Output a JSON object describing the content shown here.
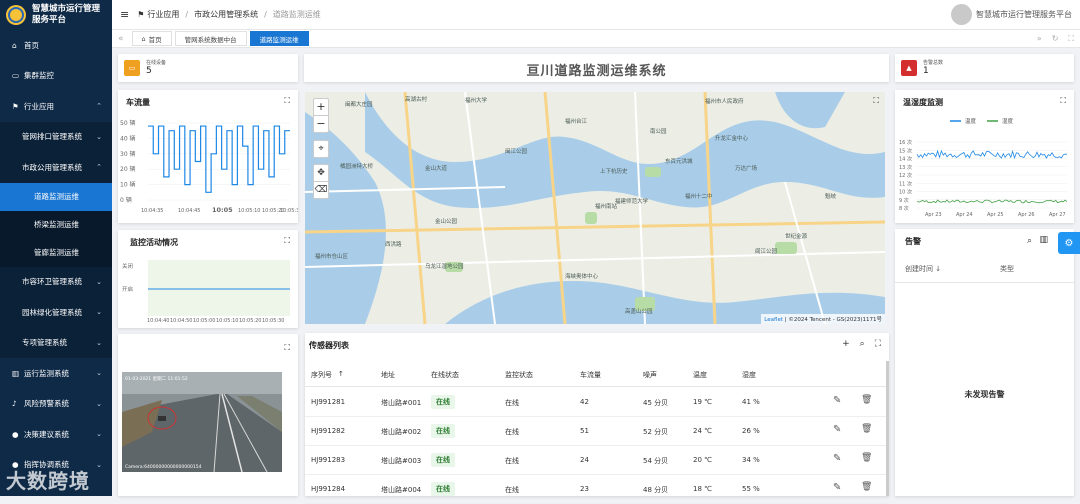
{
  "app": {
    "title_line1": "智慧城市运行管理",
    "title_line2": "服务平台",
    "user_name": "智慧城市运行管理服务平台"
  },
  "sidebar": {
    "items": [
      {
        "label": "首页",
        "icon": "home-icon",
        "level": 0
      },
      {
        "label": "集群监控",
        "icon": "monitor-icon",
        "level": 0
      },
      {
        "label": "行业应用",
        "icon": "flag-icon",
        "level": 0,
        "chevron": "⌃"
      },
      {
        "label": "管网排口管理系统",
        "level": 1,
        "chevron": "⌄"
      },
      {
        "label": "市政公用管理系统",
        "level": 1,
        "chevron": "⌃"
      },
      {
        "label": "道路监测运维",
        "level": 2,
        "active": true
      },
      {
        "label": "桥梁监测运维",
        "level": 2
      },
      {
        "label": "管廊监测运维",
        "level": 2
      },
      {
        "label": "市容环卫管理系统",
        "level": 1,
        "chevron": "⌄"
      },
      {
        "label": "园林绿化管理系统",
        "level": 1,
        "chevron": "⌄"
      },
      {
        "label": "专项管理系统",
        "level": 1,
        "chevron": "⌄"
      },
      {
        "label": "运行监测系统",
        "icon": "chart-icon",
        "level": 0,
        "chevron": "⌄"
      },
      {
        "label": "风险预警系统",
        "icon": "bell-icon",
        "level": 0,
        "chevron": "⌄"
      },
      {
        "label": "决策建议系统",
        "icon": "person-icon",
        "level": 0,
        "chevron": "⌄"
      },
      {
        "label": "指挥协调系统",
        "icon": "person-icon",
        "level": 0,
        "chevron": "⌄"
      }
    ]
  },
  "breadcrumb": {
    "item1": "行业应用",
    "item2": "市政公用管理系统",
    "item3": "道路监测运维"
  },
  "tabs": [
    {
      "label": "首页",
      "active": false
    },
    {
      "label": "管网系统数据中台",
      "active": false
    },
    {
      "label": "道路监测运维",
      "active": true
    }
  ],
  "stats": {
    "online": {
      "label": "在线设备",
      "value": "5",
      "color": "#f0a020"
    },
    "alarm": {
      "label": "告警总数",
      "value": "1",
      "color": "#d32f2f"
    }
  },
  "page_title": "亘川道路监测运维系统",
  "traffic": {
    "title": "车流量",
    "y_ticks": [
      "50 辆",
      "40 辆",
      "30 辆",
      "20 辆",
      "10 辆",
      "0 辆"
    ],
    "x_ticks": [
      "10:04:35",
      "10:04:45",
      "10:05",
      "10:05:10",
      "10:05:20",
      "10:05:30"
    ]
  },
  "monitor": {
    "title": "监控活动情况",
    "y_ticks": [
      "关闭",
      "开启"
    ],
    "x_ticks": [
      "10:04:40",
      "10:04:50",
      "10:05:00",
      "10:05:10",
      "10:05:20",
      "10:05:30"
    ]
  },
  "camera": {
    "overlay_top": "01-03-2021 星期二 11:01:52",
    "overlay_bottom": "Camera:64000000000000000154"
  },
  "map": {
    "attribution_leaflet": "Leaflet",
    "attribution_rest": " | ©2024 Tencent - GS(2023)1171号",
    "zoom_in": "+",
    "zoom_out": "−",
    "labels": [
      "闽都大庄园",
      "高湖古村",
      "福州大学",
      "福州台江",
      "南公园",
      "福州市人民政府",
      "升龙汇金中心",
      "金山大道",
      "闽江公园",
      "上下杭历史",
      "东百元洪城",
      "万达广场",
      "福州南站",
      "福建师范大学",
      "福州十二中",
      "海峡奥体中心",
      "高盖山公园",
      "乌龙江湿地公园",
      "阆江公园",
      "金山公园",
      "西洪路",
      "橘园洲特大桥",
      "福州市仓山区",
      "世纪金源",
      "魁岐"
    ]
  },
  "climate": {
    "title": "温湿度监测",
    "legend": [
      "温度",
      "湿度"
    ],
    "y_ticks": [
      "16 次",
      "15 次",
      "14 次",
      "13 次",
      "12 次",
      "11 次",
      "10 次",
      "9 次",
      "8 次"
    ],
    "x_ticks": [
      "Apr 23",
      "Apr 24",
      "Apr 25",
      "Apr 26",
      "Apr 27"
    ]
  },
  "alarms": {
    "title": "告警",
    "col_time": "创建时间",
    "col_type": "类型",
    "empty": "未发现告警"
  },
  "sensors": {
    "title": "传感器列表",
    "columns": [
      "序列号",
      "地址",
      "在线状态",
      "监控状态",
      "车流量",
      "噪声",
      "温度",
      "湿度"
    ],
    "rows": [
      {
        "id": "HJ991281",
        "addr": "塔山路#001",
        "online": "在线",
        "monitor": "在线",
        "flow": "42",
        "noise": "45 分贝",
        "temp": "19 ℃",
        "hum": "41 %"
      },
      {
        "id": "HJ991282",
        "addr": "塔山路#002",
        "online": "在线",
        "monitor": "在线",
        "flow": "51",
        "noise": "52 分贝",
        "temp": "24 ℃",
        "hum": "26 %"
      },
      {
        "id": "HJ991283",
        "addr": "塔山路#003",
        "online": "在线",
        "monitor": "在线",
        "flow": "24",
        "noise": "54 分贝",
        "temp": "20 ℃",
        "hum": "34 %"
      },
      {
        "id": "HJ991284",
        "addr": "塔山路#004",
        "online": "在线",
        "monitor": "在线",
        "flow": "23",
        "noise": "48 分贝",
        "temp": "18 ℃",
        "hum": "55 %"
      }
    ]
  },
  "watermark": "大数跨境",
  "colors": {
    "accent": "#1976d2",
    "sidebar": "#0f2a47",
    "line": "#1e88e5",
    "humidity": "#43a047",
    "monitor_bg": "#eef6e9"
  }
}
